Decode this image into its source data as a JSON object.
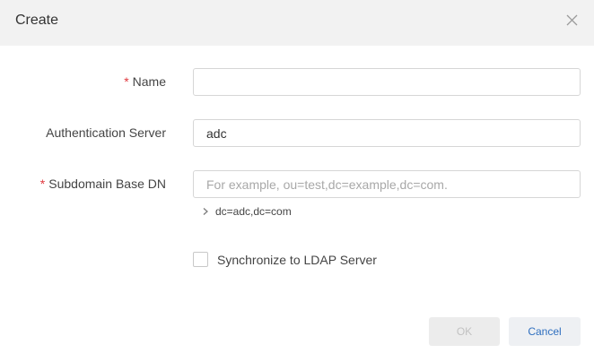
{
  "dialog": {
    "title": "Create"
  },
  "form": {
    "name": {
      "required_mark": "*",
      "label": "Name",
      "value": ""
    },
    "auth_server": {
      "label": "Authentication Server",
      "value": "adc"
    },
    "subdomain": {
      "required_mark": "*",
      "label": "Subdomain Base DN",
      "value": "",
      "placeholder": "For example, ou=test,dc=example,dc=com.",
      "hint": "dc=adc,dc=com"
    },
    "sync": {
      "label": "Synchronize to LDAP Server",
      "checked": false
    }
  },
  "footer": {
    "ok_label": "OK",
    "cancel_label": "Cancel"
  },
  "colors": {
    "required": "#e0383e",
    "link": "#2f6fbf",
    "header_bg": "#f2f2f2"
  }
}
